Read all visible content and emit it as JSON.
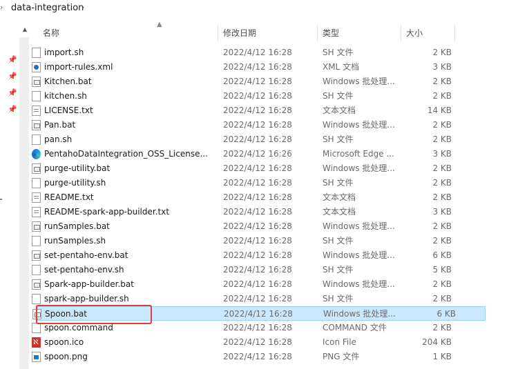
{
  "breadcrumb": {
    "sep_left": "›",
    "current": "data-integration",
    "sep_right": "›"
  },
  "header": {
    "name": "名称",
    "date": "修改日期",
    "type": "类型",
    "size": "大小",
    "sort_icon": "▲"
  },
  "pins": [
    "📌",
    "📌",
    "📌",
    "📌"
  ],
  "scroll_up": "▲",
  "files": [
    {
      "name": "import.sh",
      "date": "2022/4/12 16:28",
      "type": "SH 文件",
      "size": "2 KB",
      "icon": "sh"
    },
    {
      "name": "import-rules.xml",
      "date": "2022/4/12 16:28",
      "type": "XML 文档",
      "size": "3 KB",
      "icon": "xml"
    },
    {
      "name": "Kitchen.bat",
      "date": "2022/4/12 16:28",
      "type": "Windows 批处理...",
      "size": "2 KB",
      "icon": "bat"
    },
    {
      "name": "kitchen.sh",
      "date": "2022/4/12 16:28",
      "type": "SH 文件",
      "size": "2 KB",
      "icon": "sh"
    },
    {
      "name": "LICENSE.txt",
      "date": "2022/4/12 16:28",
      "type": "文本文档",
      "size": "14 KB",
      "icon": "txt"
    },
    {
      "name": "Pan.bat",
      "date": "2022/4/12 16:28",
      "type": "Windows 批处理...",
      "size": "2 KB",
      "icon": "bat"
    },
    {
      "name": "pan.sh",
      "date": "2022/4/12 16:28",
      "type": "SH 文件",
      "size": "2 KB",
      "icon": "sh"
    },
    {
      "name": "PentahoDataIntegration_OSS_License...",
      "date": "2022/4/12 16:26",
      "type": "Microsoft Edge ...",
      "size": "3 KB",
      "icon": "edge"
    },
    {
      "name": "purge-utility.bat",
      "date": "2022/4/12 16:28",
      "type": "Windows 批处理...",
      "size": "2 KB",
      "icon": "bat"
    },
    {
      "name": "purge-utility.sh",
      "date": "2022/4/12 16:28",
      "type": "SH 文件",
      "size": "2 KB",
      "icon": "sh"
    },
    {
      "name": "README.txt",
      "date": "2022/4/12 16:28",
      "type": "文本文档",
      "size": "2 KB",
      "icon": "txt"
    },
    {
      "name": "README-spark-app-builder.txt",
      "date": "2022/4/12 16:28",
      "type": "文本文档",
      "size": "3 KB",
      "icon": "txt"
    },
    {
      "name": "runSamples.bat",
      "date": "2022/4/12 16:28",
      "type": "Windows 批处理...",
      "size": "2 KB",
      "icon": "bat"
    },
    {
      "name": "runSamples.sh",
      "date": "2022/4/12 16:28",
      "type": "SH 文件",
      "size": "2 KB",
      "icon": "sh"
    },
    {
      "name": "set-pentaho-env.bat",
      "date": "2022/4/12 16:28",
      "type": "Windows 批处理...",
      "size": "6 KB",
      "icon": "bat"
    },
    {
      "name": "set-pentaho-env.sh",
      "date": "2022/4/12 16:28",
      "type": "SH 文件",
      "size": "5 KB",
      "icon": "sh"
    },
    {
      "name": "Spark-app-builder.bat",
      "date": "2022/4/12 16:28",
      "type": "Windows 批处理...",
      "size": "2 KB",
      "icon": "bat"
    },
    {
      "name": "spark-app-builder.sh",
      "date": "2022/4/12 16:28",
      "type": "SH 文件",
      "size": "2 KB",
      "icon": "sh"
    },
    {
      "name": "Spoon.bat",
      "date": "2022/4/12 16:28",
      "type": "Windows 批处理...",
      "size": "6 KB",
      "icon": "bat",
      "selected": true
    },
    {
      "name": "spoon.command",
      "date": "2022/4/12 16:28",
      "type": "COMMAND 文件",
      "size": "2 KB",
      "icon": "sh"
    },
    {
      "name": "spoon.ico",
      "date": "2022/4/12 16:28",
      "type": "Icon File",
      "size": "204 KB",
      "icon": "ico"
    },
    {
      "name": "spoon.png",
      "date": "2022/4/12 16:28",
      "type": "PNG 文件",
      "size": "1 KB",
      "icon": "png"
    }
  ],
  "colors": {
    "selection_bg": "#cce8ff",
    "selection_border": "#99d1ff",
    "highlight_border": "#e53935"
  }
}
